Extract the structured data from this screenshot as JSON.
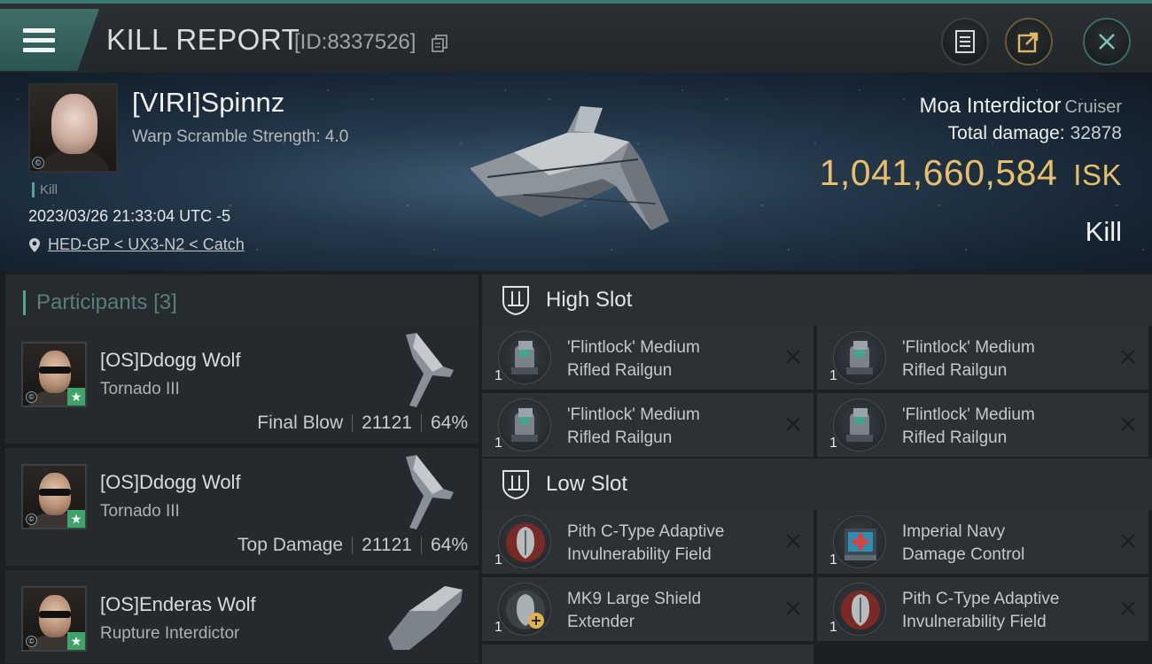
{
  "header": {
    "title": "KILL REPORT",
    "report_id": "[ID:8337526]"
  },
  "victim": {
    "name": "[VIRI]Spinnz",
    "warp_scramble": "Warp Scramble Strength: 4.0",
    "kill_tag": "Kill",
    "datetime": "2023/03/26 21:33:04 UTC -5",
    "location": "HED-GP < UX3-N2 < Catch",
    "ship_name": "Moa Interdictor",
    "ship_class": "Cruiser",
    "total_damage_label": "Total damage:",
    "total_damage": "32878",
    "isk_value": "1,041,660,584",
    "isk_unit": "ISK",
    "result": "Kill"
  },
  "participants": {
    "label": "Participants",
    "count": "[3]",
    "list": [
      {
        "name": "[OS]Ddogg Wolf",
        "ship": "Tornado III",
        "role": "Final Blow",
        "damage": "21121",
        "percent": "64%"
      },
      {
        "name": "[OS]Ddogg Wolf",
        "ship": "Tornado III",
        "role": "Top Damage",
        "damage": "21121",
        "percent": "64%"
      },
      {
        "name": "[OS]Enderas Wolf",
        "ship": "Rupture Interdictor"
      }
    ]
  },
  "fitting": {
    "high_slot": {
      "label": "High Slot",
      "modules": [
        {
          "name_line1": "'Flintlock' Medium",
          "name_line2": "Rifled Railgun",
          "qty": "1"
        },
        {
          "name_line1": "'Flintlock' Medium",
          "name_line2": "Rifled Railgun",
          "qty": "1"
        },
        {
          "name_line1": "'Flintlock' Medium",
          "name_line2": "Rifled Railgun",
          "qty": "1"
        },
        {
          "name_line1": "'Flintlock' Medium",
          "name_line2": "Rifled Railgun",
          "qty": "1"
        }
      ]
    },
    "low_slot": {
      "label": "Low Slot",
      "modules": [
        {
          "name_line1": "Pith C-Type Adaptive",
          "name_line2": "Invulnerability Field",
          "qty": "1"
        },
        {
          "name_line1": "Imperial Navy",
          "name_line2": "Damage Control",
          "qty": "1"
        },
        {
          "name_line1": "MK9 Large Shield",
          "name_line2": "Extender",
          "qty": "1"
        },
        {
          "name_line1": "Pith C-Type Adaptive",
          "name_line2": "Invulnerability Field",
          "qty": "1"
        }
      ]
    }
  },
  "colors": {
    "accent": "#4fa58f",
    "isk_gold": "#e7bf6c"
  },
  "icons": [
    "menu-icon",
    "copy-icon",
    "clipboard-icon",
    "share-icon",
    "close-icon",
    "location-pin-icon",
    "slot-icon",
    "remove-icon",
    "star-icon"
  ]
}
